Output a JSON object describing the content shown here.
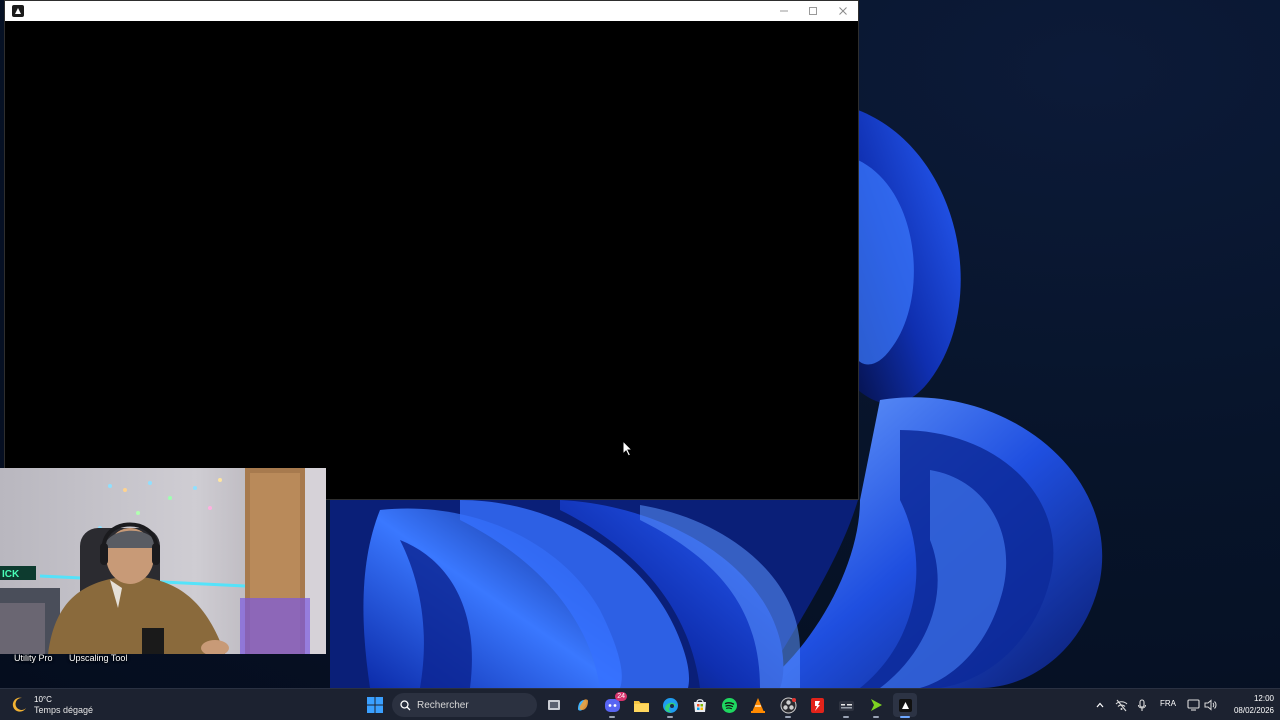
{
  "desktop": {
    "shortcuts": [
      {
        "label": "Utility Pro"
      },
      {
        "label": "Upscaling Tool"
      }
    ]
  },
  "window": {
    "title": "",
    "controls": [
      "minimize-icon",
      "maximize-icon",
      "close-icon"
    ]
  },
  "taskbar": {
    "weather": {
      "temperature": "10°C",
      "condition": "Temps dégagé",
      "icon": "moon-icon"
    },
    "search": {
      "placeholder": "Rechercher"
    },
    "apps": [
      {
        "name": "task-view",
        "icon": "task-view-icon",
        "running": false
      },
      {
        "name": "copilot",
        "icon": "copilot-icon",
        "running": false
      },
      {
        "name": "discord",
        "icon": "discord-icon",
        "running": true,
        "badge": "24"
      },
      {
        "name": "file-explorer",
        "icon": "folder-icon",
        "running": false
      },
      {
        "name": "edge",
        "icon": "edge-icon",
        "running": true
      },
      {
        "name": "microsoft-store",
        "icon": "store-icon",
        "running": false
      },
      {
        "name": "spotify",
        "icon": "spotify-icon",
        "running": false
      },
      {
        "name": "vlc",
        "icon": "vlc-icon",
        "running": false
      },
      {
        "name": "obs-studio",
        "icon": "obs-icon",
        "running": true
      },
      {
        "name": "red-app",
        "icon": "red-app-icon",
        "running": false
      },
      {
        "name": "utility-app",
        "icon": "utility-app-icon",
        "running": true
      },
      {
        "name": "green-app",
        "icon": "green-arrow-icon",
        "running": true
      },
      {
        "name": "active-app",
        "icon": "active-app-icon",
        "running": true
      }
    ],
    "tray": {
      "language": "FRA",
      "time": "12:00",
      "date": "08/02/2026"
    }
  },
  "colors": {
    "taskbar_bg": "#1c2230",
    "window_bg": "#000000",
    "titlebar_bg": "#ffffff",
    "wallpaper_accent": "#1f4fe0"
  }
}
